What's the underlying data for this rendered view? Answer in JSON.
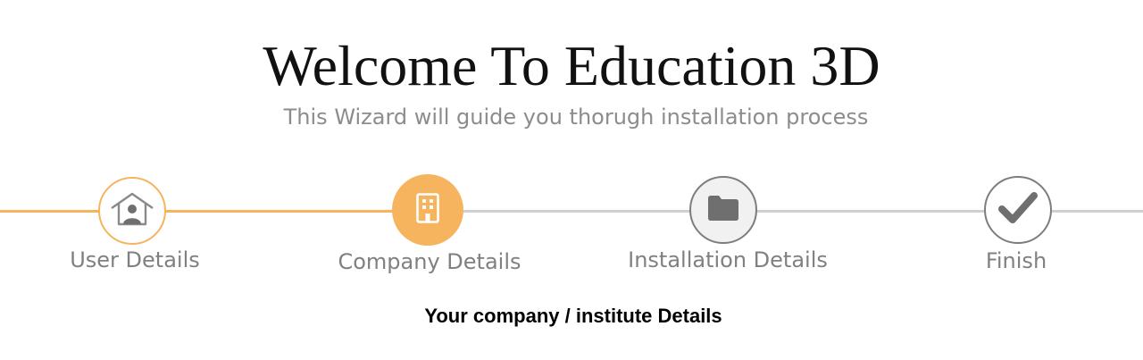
{
  "header": {
    "title": "Welcome To Education 3D",
    "subtitle": "This Wizard will guide you thorugh installation process"
  },
  "wizard": {
    "steps": [
      {
        "label": "User Details",
        "status": "complete",
        "icon": "user-home-icon"
      },
      {
        "label": "Company Details",
        "status": "active",
        "icon": "building-icon"
      },
      {
        "label": "Installation Details",
        "status": "pending",
        "icon": "folder-icon"
      },
      {
        "label": "Finish",
        "status": "pending",
        "icon": "checkmark-icon"
      }
    ]
  },
  "section": {
    "heading": "Your company / institute Details"
  },
  "colors": {
    "accent": "#f6b45e",
    "inactive_track": "#d0d0d0",
    "inactive_icon": "#7d7d7d",
    "label_text": "#808080"
  }
}
